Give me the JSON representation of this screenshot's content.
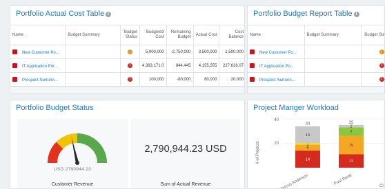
{
  "actual_cost_table": {
    "title": "Portfolio Actual Cost Table",
    "info_icon": "info-icon",
    "columns": [
      "Name",
      "Budget Summary",
      "Budget Status",
      "Budgeted Cost",
      "Remaining Budget",
      "Actual Cost",
      "Cost Balance"
    ],
    "rows": [
      {
        "name": "New Customer Po...",
        "summary": "",
        "status": "warning",
        "budgeted": "5,000,000",
        "remaining": "-2,750,000",
        "actual": "3,500,000",
        "balance": "1,500,000"
      },
      {
        "name": "IT Application Por...",
        "summary": "",
        "status": "critical",
        "budgeted": "4,383,171.0",
        "remaining": "844,445",
        "actual": "4,155,555",
        "balance": "227,616.07"
      },
      {
        "name": "Prospect Nurturin...",
        "summary": "",
        "status": "critical",
        "budgeted": "100,000",
        "remaining": "-80,000",
        "actual": "80,000",
        "balance": "20,000"
      }
    ]
  },
  "budget_report_table": {
    "title": "Portfolio Budget Report Table",
    "info_icon": "info-icon",
    "columns": [
      "Name",
      "Budget Summary",
      "Budget Status"
    ],
    "rows": [
      {
        "name": "New Customer Po...",
        "summary": "",
        "status": "warning"
      },
      {
        "name": "IT Application Po...",
        "summary": "",
        "status": "critical"
      },
      {
        "name": "Prospect Nurturin...",
        "summary": "",
        "status": "critical"
      }
    ]
  },
  "budget_status": {
    "title": "Portfolio Budget Status",
    "gauge_value": "USD 2790944.23",
    "gauge_label": "Customer Revenue",
    "big_number": "2,790,944.23 USD",
    "big_label": "Sum of Actual Revenue",
    "gauge_needle_fraction": 0.43
  },
  "workload": {
    "title": "Project Manger Workload",
    "ylabel": "# of Projects",
    "y_ticks": [
      "40",
      "20"
    ],
    "x_labels": [
      "Marcus Anderson",
      "Paul Reed"
    ],
    "totals": [
      "34",
      "35"
    ],
    "right_cut_label": "Cl"
  },
  "chart_data": {
    "type": "bar",
    "stacked": true,
    "title": "Project Manger Workload",
    "xlabel": "",
    "ylabel": "# of Projects",
    "categories": [
      "Marcus Anderson",
      "Paul Reed"
    ],
    "ylim": [
      0,
      40
    ],
    "series": [
      {
        "color": "#d52b1e",
        "values": [
          14,
          11
        ],
        "labels": [
          "14",
          "11"
        ]
      },
      {
        "color": "#f5a623",
        "values": [
          5,
          15
        ],
        "labels": [
          "5",
          "15"
        ]
      },
      {
        "color": "#f8e71c",
        "values": [
          1,
          0
        ],
        "labels": [
          "1",
          ""
        ]
      },
      {
        "color": "#8cc63f",
        "values": [
          0,
          7
        ],
        "labels": [
          "",
          "7"
        ]
      },
      {
        "color": "#c8c8c8",
        "values": [
          14,
          2
        ],
        "labels": [
          "14",
          "2"
        ]
      }
    ],
    "totals": [
      34,
      35
    ]
  },
  "colors": {
    "accent": "#1b79c4",
    "warning": "#e89417",
    "critical": "#d62a20"
  }
}
